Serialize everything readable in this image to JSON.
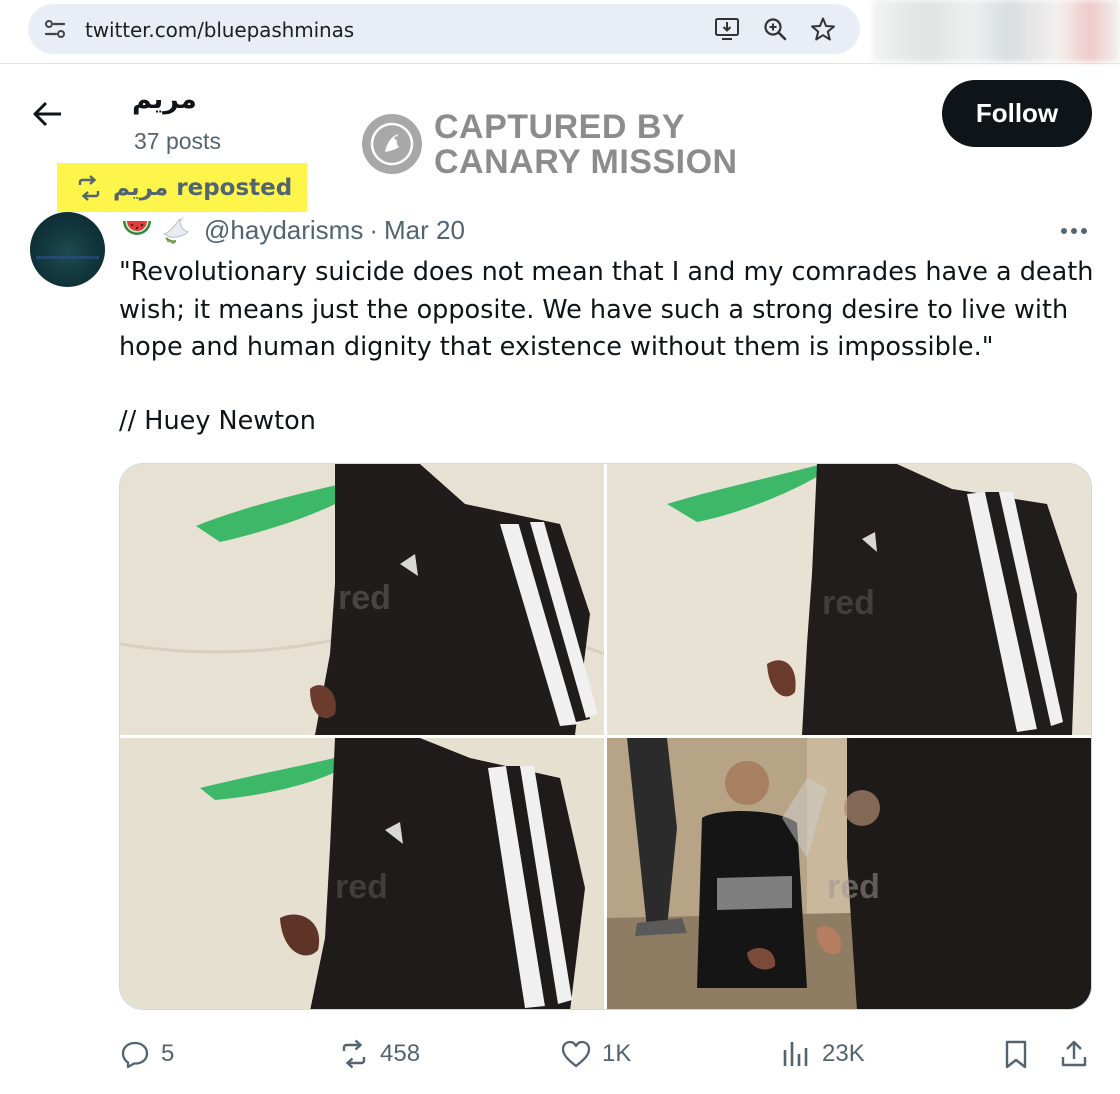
{
  "browser": {
    "url": "twitter.com/bluepashminas",
    "icons": [
      "site-info-icon",
      "install-app-icon",
      "zoom-icon",
      "bookmark-star-icon"
    ]
  },
  "profile": {
    "name": "مريم",
    "posts": "37 posts",
    "follow_label": "Follow"
  },
  "watermark": {
    "line1": "CAPTURED BY",
    "line2": "CANARY MISSION"
  },
  "repost": {
    "name": "مريم",
    "label": "reposted"
  },
  "tweet": {
    "emojis": [
      "watermelon-emoji",
      "dove-emoji"
    ],
    "handle": "@haydarisms",
    "separator": "·",
    "date": "Mar 20",
    "text_lines": [
      "\"Revolutionary suicide does not mean that I and my comrades have a death",
      "wish; it means just the opposite. We have such a strong desire to live with",
      "hope and human dignity that existence without them is impossible.\""
    ],
    "attribution": "// Huey Newton",
    "media": {
      "count": 4,
      "watermark_text": "red"
    }
  },
  "actions": {
    "replies": "5",
    "reposts": "458",
    "likes": "1K",
    "views": "23K"
  },
  "colors": {
    "text": "#0f1419",
    "secondary": "#536471",
    "follow_bg": "#0f1419",
    "highlight": "#fdf54a",
    "omnibox": "#e9edf6"
  }
}
